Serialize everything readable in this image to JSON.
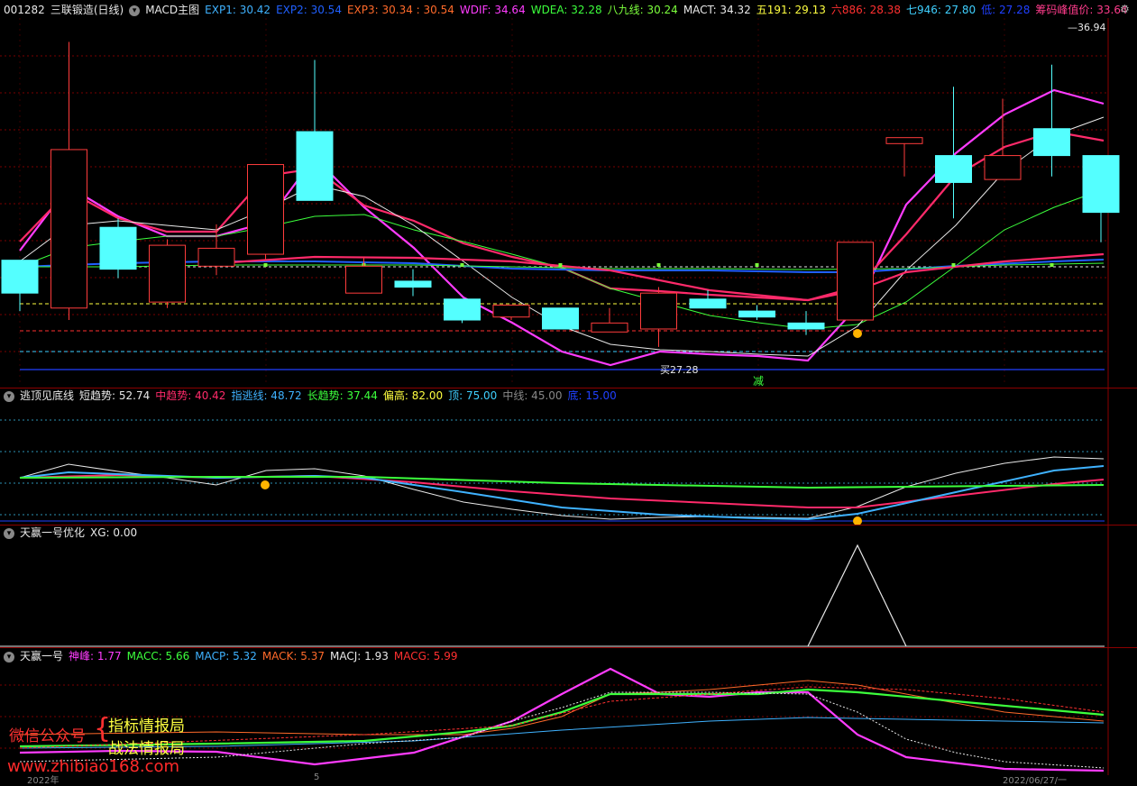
{
  "panels": {
    "main": {
      "code": "001282",
      "name": "三联锻造(日线)",
      "indicator": "MACD主图",
      "items": [
        {
          "label": "EXP1: 30.42",
          "color": "#3fb2ff"
        },
        {
          "label": "EXP2: 30.54",
          "color": "#2060ff"
        },
        {
          "label": "EXP3: 30.34 : 30.54",
          "color": "#ff6a2a"
        },
        {
          "label": "WDIF: 34.64",
          "color": "#ff3cff"
        },
        {
          "label": "WDEA: 32.28",
          "color": "#3cff3c"
        },
        {
          "label": "八九线: 30.24",
          "color": "#7cff3c"
        },
        {
          "label": "MACT: 34.32",
          "color": "#e8e8e8"
        },
        {
          "label": "五191: 29.13",
          "color": "#ffff40"
        },
        {
          "label": "六886: 28.38",
          "color": "#ff3030"
        },
        {
          "label": "七946: 27.80",
          "color": "#3fd0ff"
        },
        {
          "label": "低: 27.28",
          "color": "#2040ff"
        },
        {
          "label": "筹码峰值价: 33.64",
          "color": "#ff3c8c"
        }
      ],
      "price_label_high": "36.94",
      "price_label_low": "27.28",
      "buy_char": "买",
      "reduce_char": "减"
    },
    "panel2": {
      "title": "逃顶见底线",
      "items": [
        {
          "label": "短趋势: 52.74",
          "color": "#e8e8e8"
        },
        {
          "label": "中趋势: 40.42",
          "color": "#ff2a6a"
        },
        {
          "label": "指逃线: 48.72",
          "color": "#3fb2ff"
        },
        {
          "label": "长趋势: 37.44",
          "color": "#3cff3c"
        },
        {
          "label": "偏高: 82.00",
          "color": "#ffff40"
        },
        {
          "label": "顶: 75.00",
          "color": "#3fd0ff"
        },
        {
          "label": "中线: 45.00",
          "color": "#888888"
        },
        {
          "label": "底: 15.00",
          "color": "#2040ff"
        }
      ]
    },
    "panel3": {
      "title": "天赢一号优化",
      "items": [
        {
          "label": "XG: 0.00",
          "color": "#e8e8e8"
        }
      ]
    },
    "panel4": {
      "title": "天赢一号",
      "items": [
        {
          "label": "神峰: 1.77",
          "color": "#ff3cff"
        },
        {
          "label": "MACC: 5.66",
          "color": "#3cff3c"
        },
        {
          "label": "MACP: 5.32",
          "color": "#3fb2ff"
        },
        {
          "label": "MACK: 5.37",
          "color": "#ff6a2a"
        },
        {
          "label": "MACJ: 1.93",
          "color": "#e8e8e8"
        },
        {
          "label": "MACG: 5.99",
          "color": "#ff3030"
        }
      ]
    }
  },
  "watermark": {
    "left": "微信公众号",
    "top": "指标情报局",
    "bottom": "战法情报局",
    "url": "www.zhibiao168.com"
  },
  "axis_bottom": {
    "left": "2022年",
    "mid": "5",
    "right": "2022/06/27/一"
  },
  "colors": {
    "up": "#ff3c3c",
    "down": "#54ffff",
    "bg": "#000000",
    "grid": "#8b0000"
  },
  "chart_data": {
    "type": "candlestick",
    "ylim": [
      26.2,
      38.5
    ],
    "candles": [
      {
        "o": 30.4,
        "c": 29.3,
        "h": 30.4,
        "l": 28.7
      },
      {
        "o": 28.8,
        "c": 34.1,
        "h": 37.7,
        "l": 28.4
      },
      {
        "o": 31.5,
        "c": 30.1,
        "h": 31.8,
        "l": 29.8
      },
      {
        "o": 29.0,
        "c": 30.9,
        "h": 31.1,
        "l": 28.8
      },
      {
        "o": 30.2,
        "c": 30.8,
        "h": 31.6,
        "l": 29.9
      },
      {
        "o": 30.6,
        "c": 33.6,
        "h": 33.6,
        "l": 30.4
      },
      {
        "o": 34.7,
        "c": 32.4,
        "h": 37.1,
        "l": 32.4
      },
      {
        "o": 29.3,
        "c": 30.2,
        "h": 30.5,
        "l": 29.3
      },
      {
        "o": 29.7,
        "c": 29.5,
        "h": 30.1,
        "l": 29.2
      },
      {
        "o": 29.1,
        "c": 28.4,
        "h": 29.1,
        "l": 28.3
      },
      {
        "o": 28.5,
        "c": 28.9,
        "h": 28.9,
        "l": 28.4
      },
      {
        "o": 28.8,
        "c": 28.1,
        "h": 28.8,
        "l": 28.1
      },
      {
        "o": 28.0,
        "c": 28.3,
        "h": 28.8,
        "l": 28.0
      },
      {
        "o": 28.1,
        "c": 29.3,
        "h": 29.5,
        "l": 27.5
      },
      {
        "o": 29.1,
        "c": 28.8,
        "h": 29.4,
        "l": 28.8
      },
      {
        "o": 28.7,
        "c": 28.5,
        "h": 28.9,
        "l": 28.4
      },
      {
        "o": 28.3,
        "c": 28.1,
        "h": 28.7,
        "l": 27.9
      },
      {
        "o": 28.4,
        "c": 31.0,
        "h": 31.0,
        "l": 28.4
      },
      {
        "o": 34.3,
        "c": 34.5,
        "h": 34.5,
        "l": 33.2
      },
      {
        "o": 33.9,
        "c": 33.0,
        "h": 36.2,
        "l": 31.8
      },
      {
        "o": 33.1,
        "c": 33.9,
        "h": 35.8,
        "l": 33.1
      },
      {
        "o": 34.8,
        "c": 33.9,
        "h": 36.94,
        "l": 33.2
      },
      {
        "o": 33.9,
        "c": 32.0,
        "h": 33.9,
        "l": 31.0
      }
    ]
  }
}
